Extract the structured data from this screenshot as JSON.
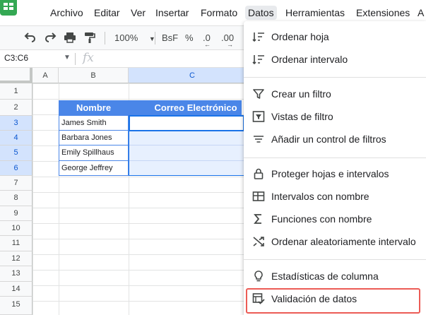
{
  "menubar": {
    "items": [
      "Archivo",
      "Editar",
      "Ver",
      "Insertar",
      "Formato",
      "Datos",
      "Herramientas",
      "Extensiones",
      "A"
    ],
    "active_index": 5
  },
  "toolbar": {
    "zoom": "100%",
    "currency": "BsF",
    "percent": "%",
    "decrease_decimals": ".0",
    "increase_decimals": ".00"
  },
  "formula_bar": {
    "name_box": "C3:C6",
    "fx_label": "fx"
  },
  "sheet": {
    "columns": [
      "A",
      "B",
      "C"
    ],
    "rows": [
      "1",
      "2",
      "3",
      "4",
      "5",
      "6",
      "7",
      "8",
      "9",
      "10",
      "11",
      "12",
      "13",
      "14",
      "15"
    ],
    "header_name": "Nombre",
    "header_email": "Correo Electrónico",
    "names": [
      "James Smith",
      "Barbara Jones",
      "Emily Spillhaus",
      "George Jeffrey"
    ]
  },
  "data_menu": {
    "groups": [
      [
        {
          "label": "Ordenar hoja",
          "icon": "sort-icon"
        },
        {
          "label": "Ordenar intervalo",
          "icon": "sort-range-icon"
        }
      ],
      [
        {
          "label": "Crear un filtro",
          "icon": "filter-icon"
        },
        {
          "label": "Vistas de filtro",
          "icon": "filter-views-icon"
        },
        {
          "label": "Añadir un control de filtros",
          "icon": "slicer-icon"
        }
      ],
      [
        {
          "label": "Proteger hojas e intervalos",
          "icon": "lock-icon"
        },
        {
          "label": "Intervalos con nombre",
          "icon": "named-ranges-icon"
        },
        {
          "label": "Funciones con nombre",
          "icon": "sigma-icon"
        },
        {
          "label": "Ordenar aleatoriamente intervalo",
          "icon": "shuffle-icon"
        }
      ],
      [
        {
          "label": "Estadísticas de columna",
          "icon": "lightbulb-icon"
        },
        {
          "label": "Validación de datos",
          "icon": "data-validation-icon"
        }
      ]
    ],
    "highlighted": "Validación de datos"
  },
  "colors": {
    "header_fill": "#4a86e8",
    "selection_fill": "#e7f0fe",
    "selection_border": "#1a73e8",
    "highlight_box": "#ec5b55",
    "sheets_green": "#34a853"
  }
}
